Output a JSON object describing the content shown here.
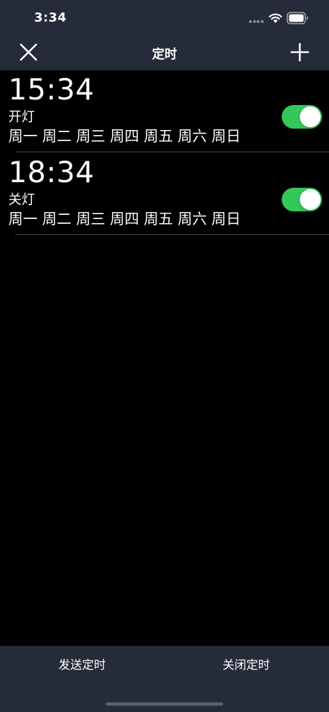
{
  "status_bar": {
    "time": "3:34"
  },
  "nav": {
    "title": "定时",
    "close_icon": "close-icon",
    "add_icon": "plus-icon"
  },
  "timers": [
    {
      "time": "15:34",
      "name": "开灯",
      "days": "周一 周二 周三 周四 周五 周六 周日",
      "enabled": true
    },
    {
      "time": "18:34",
      "name": "关灯",
      "days": "周一 周二 周三 周四 周五 周六 周日",
      "enabled": true
    }
  ],
  "bottom": {
    "send_label": "发送定时",
    "close_label": "关闭定时"
  },
  "colors": {
    "bar_background": "#252b38",
    "page_background": "#000000",
    "toggle_on": "#34c759"
  }
}
